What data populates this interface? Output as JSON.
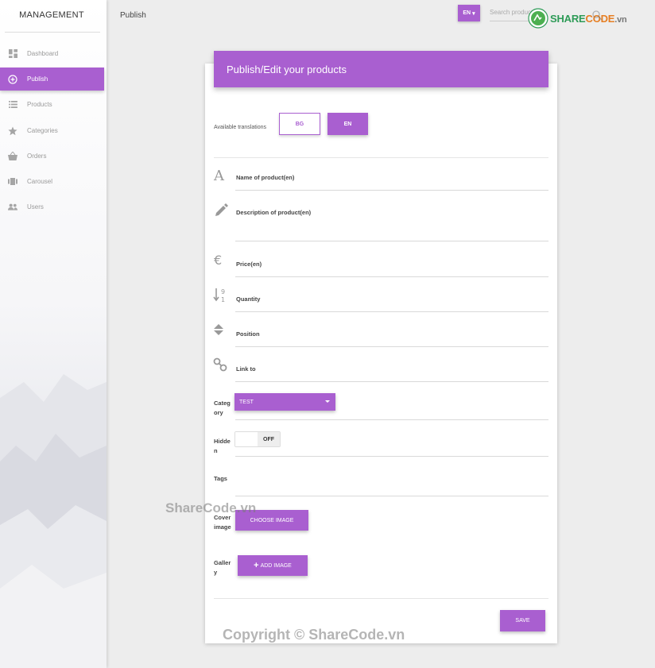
{
  "sidebar": {
    "brand": "MANAGEMENT",
    "items": [
      {
        "label": "Dashboard",
        "icon": "dashboard-icon"
      },
      {
        "label": "Publish",
        "icon": "add-circle-icon",
        "active": true
      },
      {
        "label": "Products",
        "icon": "list-icon"
      },
      {
        "label": "Categories",
        "icon": "star-icon"
      },
      {
        "label": "Orders",
        "icon": "basket-icon"
      },
      {
        "label": "Carousel",
        "icon": "carousel-icon"
      },
      {
        "label": "Users",
        "icon": "users-icon"
      }
    ]
  },
  "header": {
    "breadcrumb": "Publish",
    "language_button": "EN",
    "search_placeholder": "Search products",
    "logo_text_a": "SHARE",
    "logo_text_b": "CODE",
    "logo_text_c": ".vn"
  },
  "form": {
    "title": "Publish/Edit your products",
    "translations_label": "Available translations",
    "translations": [
      "BG",
      "EN"
    ],
    "fields": {
      "name": "Name of product(en)",
      "description": "Description of product(en)",
      "price": "Price(en)",
      "quantity": "Quantity",
      "position": "Position",
      "link": "Link to"
    },
    "category_label": "Categ ory",
    "category_value": "TEST",
    "hidden_label": "Hidde n",
    "hidden_state": "OFF",
    "tags_label": "Tags",
    "cover_label": "Cover image",
    "cover_button": "CHOOSE IMAGE",
    "gallery_label": "Galler y",
    "gallery_button": "ADD IMAGE",
    "save_button": "SAVE"
  },
  "watermarks": {
    "mid": "ShareCode.vn",
    "bottom": "Copyright © ShareCode.vn"
  },
  "colors": {
    "accent": "#a95fd0",
    "background": "#ededed"
  }
}
